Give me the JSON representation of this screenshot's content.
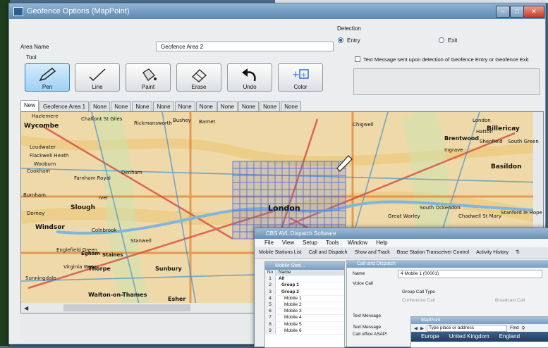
{
  "window": {
    "title": "Geofence Options (MapPoint)"
  },
  "form": {
    "area_name_label": "Area Name",
    "area_name_value": "Geofence Area 2",
    "tool_label": "Tool",
    "tools": [
      {
        "name": "pen",
        "label": "Pen"
      },
      {
        "name": "line",
        "label": "Line"
      },
      {
        "name": "paint",
        "label": "Paint"
      },
      {
        "name": "erase",
        "label": "Erase"
      },
      {
        "name": "undo",
        "label": "Undo"
      },
      {
        "name": "color",
        "label": "Color"
      }
    ]
  },
  "detection": {
    "label": "Detection",
    "entry_label": "Entry",
    "exit_label": "Exit",
    "selected": "Entry",
    "message_checkbox_label": "Text Message sent upon detection of Geofence Entry or Geofence Exit"
  },
  "tabs": [
    "New",
    "Geofence Area 1",
    "None",
    "None",
    "None",
    "None",
    "None",
    "None",
    "None",
    "None",
    "None",
    "None"
  ],
  "map": {
    "labels": [
      "Wycombe",
      "Hazlemere",
      "Chalfont St Giles",
      "Rickmansworth",
      "Bushey",
      "Barnet",
      "Chigwell",
      "Hutton",
      "Billericay",
      "Brentwood",
      "Loudwater",
      "Flackwell Heath",
      "Wooburn",
      "Cookham",
      "Farnham Royal",
      "Denham",
      "Ingrave",
      "Basildon",
      "Burnham",
      "Slough",
      "Iver",
      "London",
      "South Ockendon",
      "Chadwell St Mary",
      "Stanford le Hope",
      "Dorney",
      "Windsor",
      "Colnbrook",
      "Stanwell",
      "Englefield Green",
      "Egham",
      "Staines",
      "Virginia Water",
      "Thorpe",
      "Sunningdale",
      "Sunbury",
      "Walton-on-Thames",
      "Esher",
      "Hatton",
      "Shenfield",
      "Great Warley",
      "South Green"
    ]
  },
  "dispatch": {
    "title": "CBS AVL Dispatch Software",
    "menu": [
      "File",
      "View",
      "Setup",
      "Tools",
      "Window",
      "Help"
    ],
    "toolbar": [
      "Mobile Stations List",
      "Call and Dispatch",
      "Show and Track",
      "Base Station Transceiver Control",
      "Activity History",
      "Ti"
    ],
    "stations_pane": {
      "title": "Mobile Stati...",
      "columns": [
        "No",
        "Name"
      ],
      "rows": [
        {
          "no": "1",
          "name": "All"
        },
        {
          "no": "2",
          "name": "Group 1"
        },
        {
          "no": "3",
          "name": "Group 2"
        },
        {
          "no": "4",
          "name": "Mobile 1"
        },
        {
          "no": "5",
          "name": "Mobile 2"
        },
        {
          "no": "6",
          "name": "Mobile 3"
        },
        {
          "no": "7",
          "name": "Mobile 4"
        },
        {
          "no": "8",
          "name": "Mobile 5"
        },
        {
          "no": "9",
          "name": "Mobile 6"
        }
      ]
    },
    "call_pane": {
      "title": "Call and Dispatch",
      "name_label": "Name",
      "name_value": "4 Mobile 1 (00001)",
      "voice_call_label": "Voice Call",
      "group_call_type_label": "Group Call Type",
      "conference_label": "Conference Call",
      "broadcast_label": "Broadcast Call",
      "text_message_label": "Text Message",
      "text_message2_label": "Text Message",
      "text_message_value": "Call office ASAP!"
    },
    "mappoint": {
      "title": "MapPoint",
      "search_placeholder": "Type place or address",
      "find_label": "Find",
      "strip": [
        "Europe",
        "United Kingdom",
        "England"
      ]
    }
  }
}
